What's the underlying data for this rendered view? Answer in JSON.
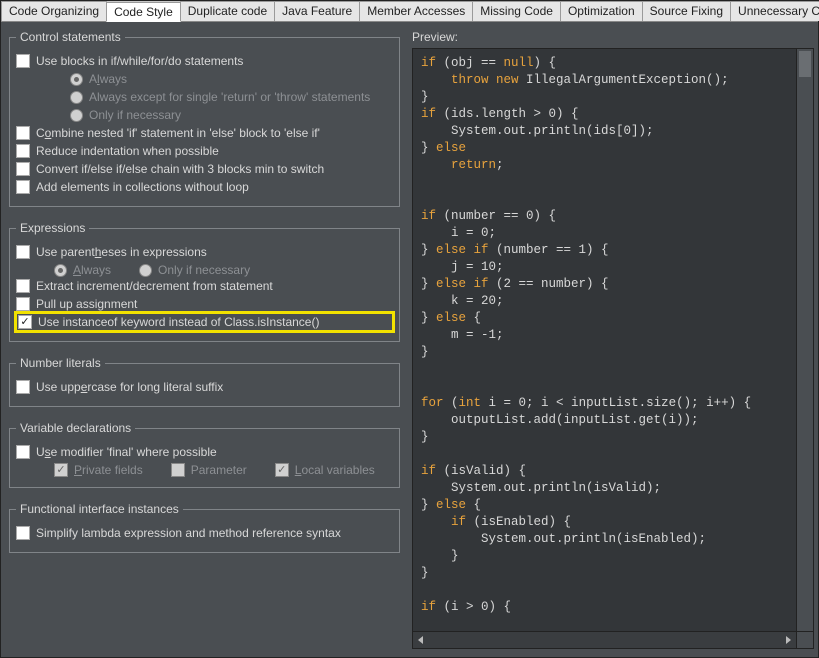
{
  "tabs": {
    "items": [
      "Code Organizing",
      "Code Style",
      "Duplicate code",
      "Java Feature",
      "Member Accesses",
      "Missing Code",
      "Optimization",
      "Source Fixing",
      "Unnecessary Code"
    ],
    "active_index": 1
  },
  "preview_label": "Preview:",
  "groups": {
    "control": {
      "legend": "Control statements",
      "use_blocks": "Use blocks in if/while/for/do statements",
      "always": "Always",
      "always_except": "Always except for single 'return' or 'throw' statements",
      "only_if": "Only if necessary",
      "combine": "Combine nested 'if' statement in 'else' block to 'else if'",
      "reduce": "Reduce indentation when possible",
      "convert": "Convert if/else if/else chain with 3 blocks min to switch",
      "add_elements": "Add elements in collections without loop"
    },
    "expressions": {
      "legend": "Expressions",
      "use_paren": "Use parentheses in expressions",
      "always": "Always",
      "only_if": "Only if necessary",
      "extract": "Extract increment/decrement from statement",
      "pullup": "Pull up assignment",
      "instanceof": "Use instanceof keyword instead of Class.isInstance()"
    },
    "number": {
      "legend": "Number literals",
      "uppercase": "Use uppercase for long literal suffix"
    },
    "variable": {
      "legend": "Variable declarations",
      "use_final": "Use modifier 'final' where possible",
      "private": "Private fields",
      "parameter": "Parameter",
      "local": "Local variables"
    },
    "func": {
      "legend": "Functional interface instances",
      "simplify": "Simplify lambda expression and method reference syntax"
    }
  },
  "code": {
    "l1a": "if",
    "l1b": " (obj == ",
    "l1c": "null",
    "l1d": ") {",
    "l2a": "    ",
    "l2b": "throw new",
    "l2c": " IllegalArgumentException();",
    "l3": "}",
    "l4a": "if",
    "l4b": " (ids.length > 0) {",
    "l5": "    System.out.println(ids[0]);",
    "l6a": "} ",
    "l6b": "else",
    "l7a": "    ",
    "l7b": "return",
    "l7c": ";",
    "blank": "",
    "l9a": "if",
    "l9b": " (number == 0) {",
    "l10": "    i = 0;",
    "l11a": "} ",
    "l11b": "else if",
    "l11c": " (number == 1) {",
    "l12": "    j = 10;",
    "l13a": "} ",
    "l13b": "else if",
    "l13c": " (2 == number) {",
    "l14": "    k = 20;",
    "l15a": "} ",
    "l15b": "else",
    "l15c": " {",
    "l16": "    m = -1;",
    "l17": "}",
    "l19a": "for",
    "l19b": " (",
    "l19c": "int",
    "l19d": " i = 0; i < inputList.size(); i++) {",
    "l20": "    outputList.add(inputList.get(i));",
    "l21": "}",
    "l23a": "if",
    "l23b": " (isValid) {",
    "l24": "    System.out.println(isValid);",
    "l25a": "} ",
    "l25b": "else",
    "l25c": " {",
    "l26a": "    ",
    "l26b": "if",
    "l26c": " (isEnabled) {",
    "l27": "        System.out.println(isEnabled);",
    "l28": "    }",
    "l29": "}",
    "l31a": "if",
    "l31b": " (i > 0) {"
  }
}
